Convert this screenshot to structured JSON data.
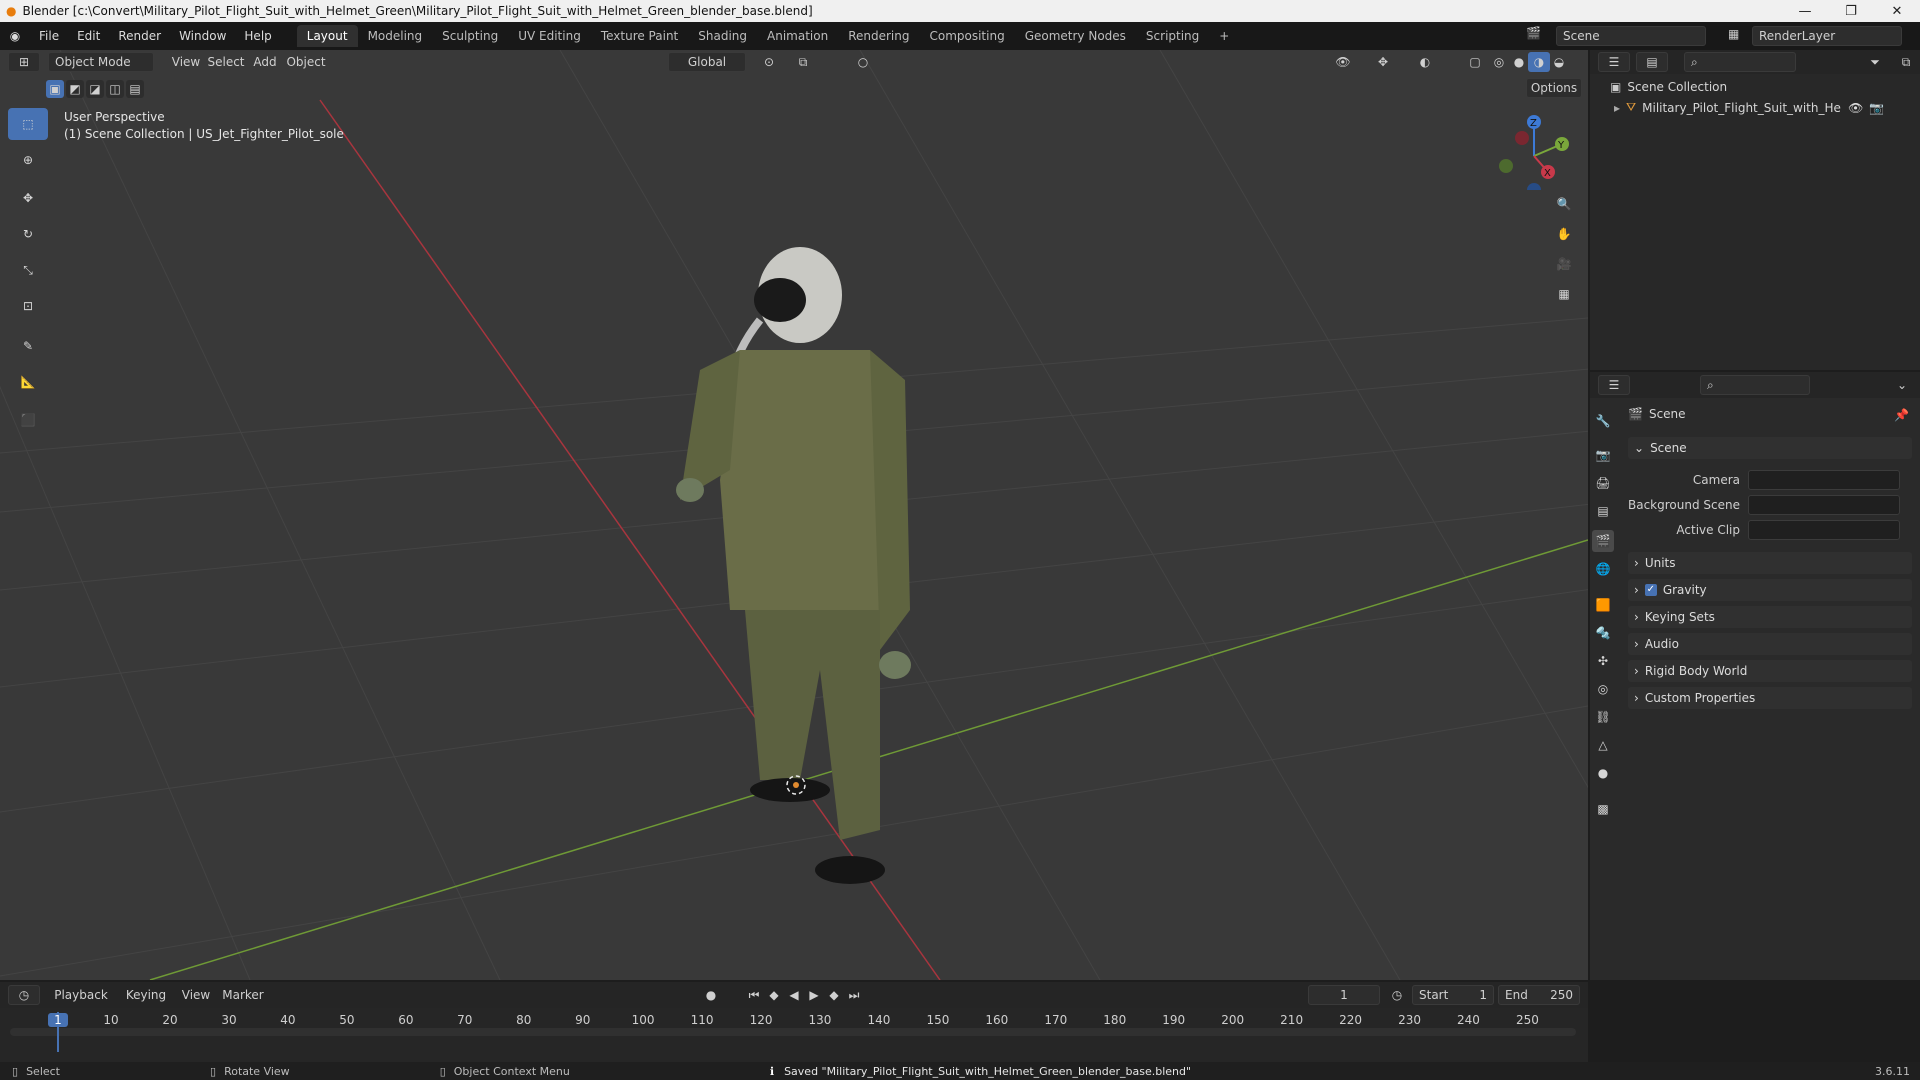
{
  "window": {
    "title": "Blender [c:\\Convert\\Military_Pilot_Flight_Suit_with_Helmet_Green\\Military_Pilot_Flight_Suit_with_Helmet_Green_blender_base.blend]",
    "minimize": "—",
    "maximize": "❐",
    "close": "✕"
  },
  "menu": [
    "File",
    "Edit",
    "Render",
    "Window",
    "Help"
  ],
  "workspaces": [
    "Layout",
    "Modeling",
    "Sculpting",
    "UV Editing",
    "Texture Paint",
    "Shading",
    "Animation",
    "Rendering",
    "Compositing",
    "Geometry Nodes",
    "Scripting"
  ],
  "active_workspace": "Layout",
  "add_workspace": "+",
  "scene_selector": "Scene",
  "layer_selector": "RenderLayer",
  "viewport_header": {
    "mode": "Object Mode",
    "menus": [
      "View",
      "Select",
      "Add",
      "Object"
    ],
    "orientation": "Global",
    "options": "Options"
  },
  "viewport": {
    "perspective": "User Perspective",
    "collection_info": "(1) Scene Collection | US_Jet_Fighter_Pilot_sole",
    "gizmo": {
      "x": "X",
      "y": "Y",
      "z": "Z"
    }
  },
  "outliner": {
    "root": "Scene Collection",
    "items": [
      "Military_Pilot_Flight_Suit_with_Helmet_"
    ]
  },
  "properties": {
    "title": "Scene",
    "scene_panel": "Scene",
    "camera_label": "Camera",
    "background_label": "Background Scene",
    "clip_label": "Active Clip",
    "sections": [
      "Units",
      "Gravity",
      "Keying Sets",
      "Audio",
      "Rigid Body World",
      "Custom Properties"
    ],
    "gravity_checked": true
  },
  "timeline": {
    "menus": [
      "Playback",
      "Keying",
      "View",
      "Marker"
    ],
    "current_frame": "1",
    "start_label": "Start",
    "start": "1",
    "end_label": "End",
    "end": "250",
    "ruler": [
      "1",
      "10",
      "20",
      "30",
      "40",
      "50",
      "60",
      "70",
      "80",
      "90",
      "100",
      "110",
      "120",
      "130",
      "140",
      "150",
      "160",
      "170",
      "180",
      "190",
      "200",
      "210",
      "220",
      "230",
      "240",
      "250"
    ]
  },
  "status": {
    "select": "Select",
    "rotate": "Rotate View",
    "context": "Object Context Menu",
    "message": "Saved \"Military_Pilot_Flight_Suit_with_Helmet_Green_blender_base.blend\"",
    "version": "3.6.11"
  },
  "colors": {
    "accent": "#4772b3",
    "x_axis": "#c8394a",
    "y_axis": "#7aa83b",
    "z_axis": "#3d7ad6",
    "viewport_bg": "#393939"
  }
}
